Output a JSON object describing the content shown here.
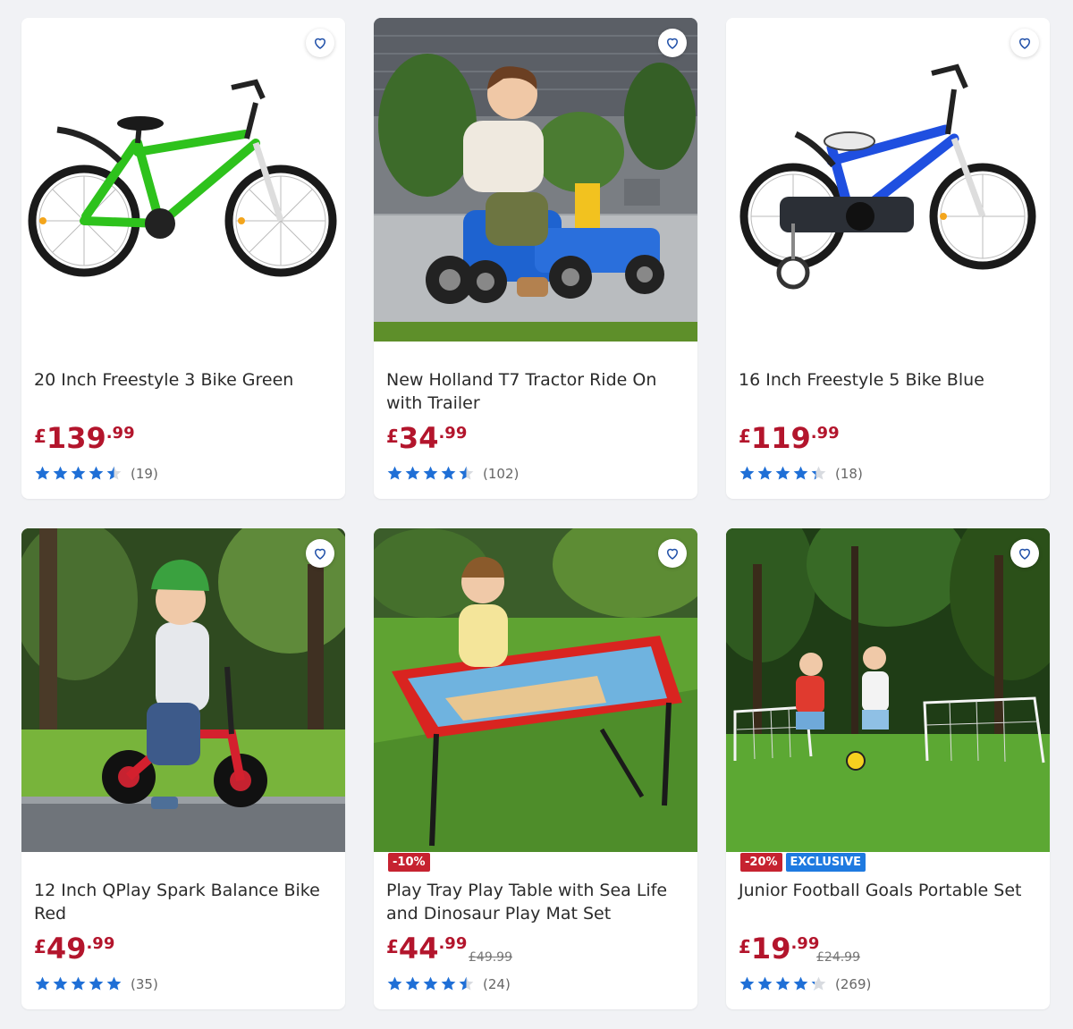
{
  "products": [
    {
      "title": "20 Inch Freestyle 3 Bike Green",
      "currency": "£",
      "pounds": "139",
      "pence": ".99",
      "was": "",
      "badges": [],
      "rating": 4.5,
      "count": "(19)",
      "image": "green-freestyle-bike"
    },
    {
      "title": "New Holland T7 Tractor Ride On with Trailer",
      "currency": "£",
      "pounds": "34",
      "pence": ".99",
      "was": "",
      "badges": [],
      "rating": 4.5,
      "count": "(102)",
      "image": "toddler-on-blue-tractor"
    },
    {
      "title": "16 Inch Freestyle 5 Bike Blue",
      "currency": "£",
      "pounds": "119",
      "pence": ".99",
      "was": "",
      "badges": [],
      "rating": 4.3,
      "count": "(18)",
      "image": "blue-freestyle-bike"
    },
    {
      "title": "12 Inch QPlay Spark Balance Bike Red",
      "currency": "£",
      "pounds": "49",
      "pence": ".99",
      "was": "",
      "badges": [],
      "rating": 5,
      "count": "(35)",
      "image": "child-on-red-balance-bike"
    },
    {
      "title": "Play Tray Play Table with Sea Life and Dinosaur Play Mat Set",
      "currency": "£",
      "pounds": "44",
      "pence": ".99",
      "was": "£49.99",
      "badges": [
        {
          "text": "-10%",
          "kind": "discount"
        }
      ],
      "rating": 4.5,
      "count": "(24)",
      "image": "girl-at-play-tray-table"
    },
    {
      "title": "Junior Football Goals Portable Set",
      "currency": "£",
      "pounds": "19",
      "pence": ".99",
      "was": "£24.99",
      "badges": [
        {
          "text": "-20%",
          "kind": "discount"
        },
        {
          "text": "EXCLUSIVE",
          "kind": "exclusive"
        }
      ],
      "rating": 4.2,
      "count": "(269)",
      "image": "kids-playing-football-goals"
    }
  ],
  "colors": {
    "price": "#b3152c",
    "star": "#1f6fd6",
    "star_empty": "#d8dbe0",
    "discount": "#c62230",
    "exclusive": "#1f7ae0",
    "heart": "#1f4fa8"
  },
  "icons": {
    "favourite": "heart-outline-icon",
    "rating": "star-icon"
  }
}
